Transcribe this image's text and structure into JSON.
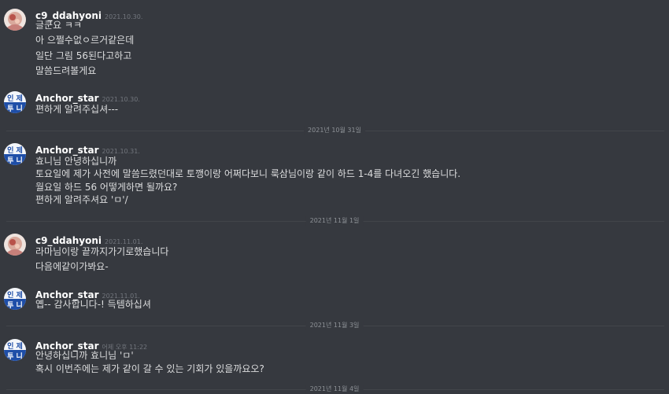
{
  "users": {
    "ddahyoni": "c9_ddahyoni",
    "anchor": "Anchor_star"
  },
  "avatars": {
    "anchor_text_top": "인 제",
    "anchor_text_bottom": "투 니"
  },
  "messages": [
    {
      "author": "c9_ddahyoni",
      "timestamp": "2021.10.30.",
      "lines": [
        "글쿤요 ㅋㅋ",
        "아 으쩔수없ㅇ르거같은데",
        "일단 그림 56된다고하고",
        "말씀드려볼게요"
      ]
    },
    {
      "author": "Anchor_star",
      "timestamp": "2021.10.30.",
      "lines": [
        "편하게 알려주십셔---"
      ]
    },
    {
      "author": "Anchor_star",
      "timestamp": "2021.10.31.",
      "lines": [
        "효니님 안녕하십니까",
        "토요일에 제가 사전에 말씀드렸던대로 토깽이랑 어쩌다보니 룩삼님이랑 같이 하드 1-4를 다녀오긴 했습니다.",
        "월요일 하드 56 어떻게하면 될까요?",
        "편하게 알려주셔요 'ㅁ'/"
      ]
    },
    {
      "author": "c9_ddahyoni",
      "timestamp": "2021.11.01.",
      "lines": [
        "라마님이랑 끝까지가기로했습니다",
        "다음에같이가봐요-"
      ]
    },
    {
      "author": "Anchor_star",
      "timestamp": "2021.11.01.",
      "lines": [
        "옙-- 감사합니다-! 득템하십셔"
      ]
    },
    {
      "author": "Anchor_star",
      "timestamp": "어제 오후 11:22",
      "lines": [
        "안녕하십니까 효니님 'ㅁ'",
        "혹시 이번주에는 제가 같이 갈 수 있는 기회가 있을까요오?"
      ]
    }
  ],
  "dividers": [
    "2021년 10월 31일",
    "2021년 11월 1일",
    "2021년 11월 3일",
    "2021년 11월 4일"
  ]
}
